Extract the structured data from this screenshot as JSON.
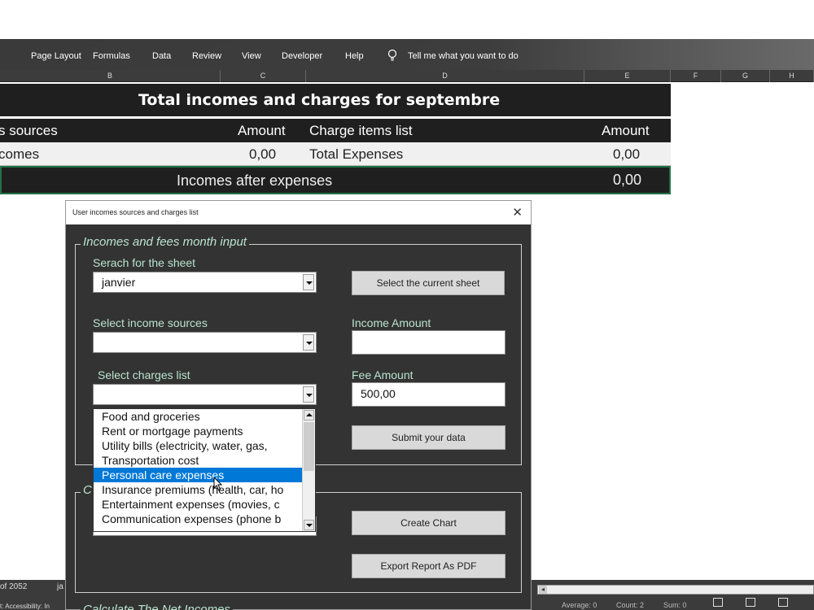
{
  "ribbon": {
    "tabs": [
      "Page Layout",
      "Formulas",
      "Data",
      "Review",
      "View",
      "Developer",
      "Help"
    ],
    "tell_me": "Tell me what you want to do"
  },
  "columns": [
    "B",
    "C",
    "D",
    "E",
    "F",
    "G",
    "H"
  ],
  "sheet": {
    "title": "Total incomes and charges for septembre",
    "headers": {
      "sources": "s sources",
      "amount1": "Amount",
      "charges": "Charge items list",
      "amount2": "Amount"
    },
    "values": {
      "incomes": "comes",
      "income_amount": "0,00",
      "expenses": "Total Expenses",
      "expense_amount": "0,00"
    },
    "after": {
      "label": "Incomes after expenses",
      "value": "0,00"
    }
  },
  "status": {
    "record": "of 2052",
    "sheet_tab": "ja",
    "accessibility": "t: Accessibility: In",
    "average": "Average: 0",
    "count": "Count: 2",
    "sum": "Sum: 0"
  },
  "dialog": {
    "title": "User incomes sources and charges list",
    "frame1_label": "Incomes and fees month  input",
    "search_label": "Serach for the sheet",
    "search_value": "janvier",
    "select_sheet_button": "Select the current sheet",
    "income_sources_label": "Select income sources",
    "income_sources_value": "",
    "income_amount_label": "Income Amount",
    "income_amount_value": "",
    "charges_label": "Select charges list",
    "charges_value": "",
    "fee_amount_label": "Fee Amount",
    "fee_amount_value": "500,00",
    "submit_button": "Submit your data",
    "frame2_label": "C",
    "create_chart_button": "Create Chart",
    "export_pdf_button": "Export Report As PDF",
    "frame3_label": "Calculate The Net Incomes",
    "charges_options": [
      "Food and groceries",
      "Rent or mortgage payments",
      "Utility bills (electricity, water, gas,",
      "Transportation cost",
      "Personal care expenses",
      "Insurance premiums (health, car, ho",
      "Entertainment expenses (movies, c",
      "Communication expenses (phone b"
    ],
    "selected_option_index": 4
  },
  "colors": {
    "dialog_bg": "#333333",
    "label_text": "#b9e3cf",
    "selection": "#0078d7",
    "sheet_dark": "#1f1f1f",
    "excel_green": "#217346"
  }
}
